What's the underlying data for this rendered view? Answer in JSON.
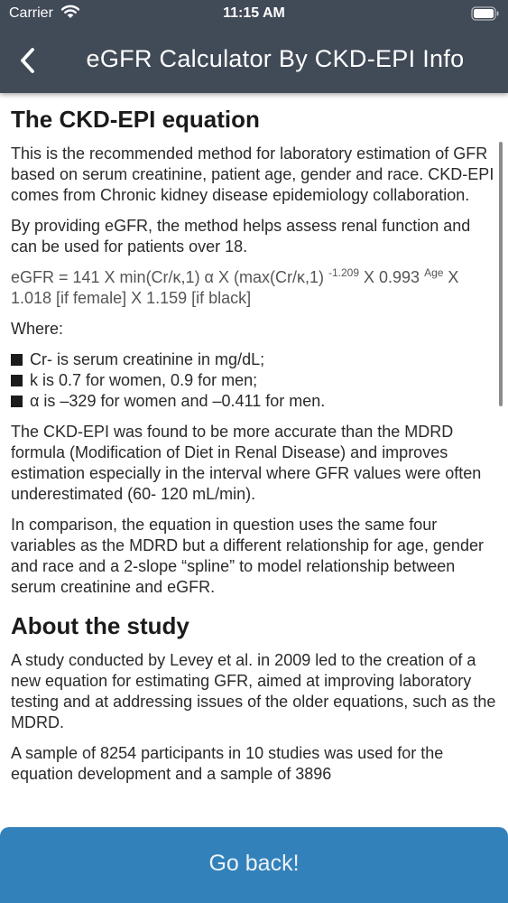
{
  "status_bar": {
    "carrier": "Carrier",
    "time": "11:15 AM"
  },
  "nav": {
    "title": "eGFR Calculator By CKD-EPI Info",
    "back_icon": "chevron-left-icon"
  },
  "article": {
    "heading_1": "The CKD-EPI equation",
    "p1": "This is the recommended method for laboratory estimation of GFR based on serum creatinine, patient age, gender and race. CKD-EPI comes from Chronic kidney disease epidemiology collaboration.",
    "p2": "By providing eGFR, the method helps assess renal function and can be used for patients over 18.",
    "formula": {
      "part1": "eGFR = 141 X min(Cr/κ,1) α X (max(Cr/κ,1) ",
      "sup1": "-1.209",
      "part2": " X 0.993 ",
      "sup2": "Age",
      "part3": " X 1.018 [if female] X 1.159 [if black]"
    },
    "where": "Where:",
    "bullets": [
      "Cr- is serum creatinine in mg/dL;",
      "k is 0.7 for women, 0.9 for men;",
      "α is –329 for women and –0.411 for men."
    ],
    "p3": "The CKD-EPI was found to be more accurate than the MDRD formula (Modification of Diet in Renal Disease) and improves estimation especially in the interval where GFR values were often underestimated (60- 120 mL/min).",
    "p4": "In comparison, the equation in question uses the same four variables as the MDRD but a different relationship for age, gender and race and a 2-slope “spline” to model relationship between serum creatinine and eGFR.",
    "heading_2": "About the study",
    "p5": "A study conducted by Levey et al. in 2009 led to the creation of a new equation for estimating GFR, aimed at improving laboratory testing and at addressing issues of the older equations, such as the MDRD.",
    "p6": "A sample of 8254 participants in 10 studies was used for the equation development and a sample of 3896"
  },
  "footer": {
    "go_back_label": "Go back!"
  },
  "colors": {
    "nav_background": "#414a57",
    "button_background": "#3381ba"
  }
}
